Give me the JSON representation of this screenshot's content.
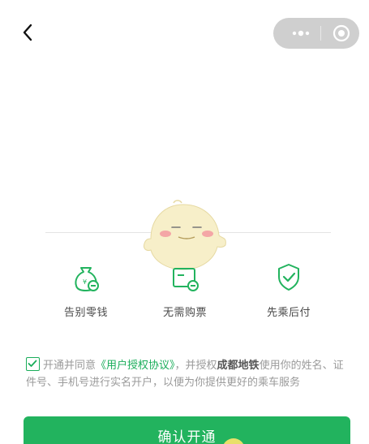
{
  "nav": {
    "back_icon": "chevron-left-icon",
    "menu_icon": "more-dots-icon",
    "close_icon": "target-circle-icon"
  },
  "features": [
    {
      "label": "告别零钱",
      "icon": "money-bag-icon"
    },
    {
      "label": "无需购票",
      "icon": "ticket-icon"
    },
    {
      "label": "先乘后付",
      "icon": "shield-check-icon"
    }
  ],
  "agreement": {
    "checked": true,
    "prefix": "开通并同意",
    "link": "《用户授权协议》",
    "middle": "，并授权",
    "bold": "成都地铁",
    "suffix": "使用你的姓名、证件号、手机号进行实名开户，以便为你提供更好的乘车服务"
  },
  "confirm_button": "确认开通",
  "colors": {
    "accent": "#22b35e",
    "capsule": "#cfcfcf"
  }
}
